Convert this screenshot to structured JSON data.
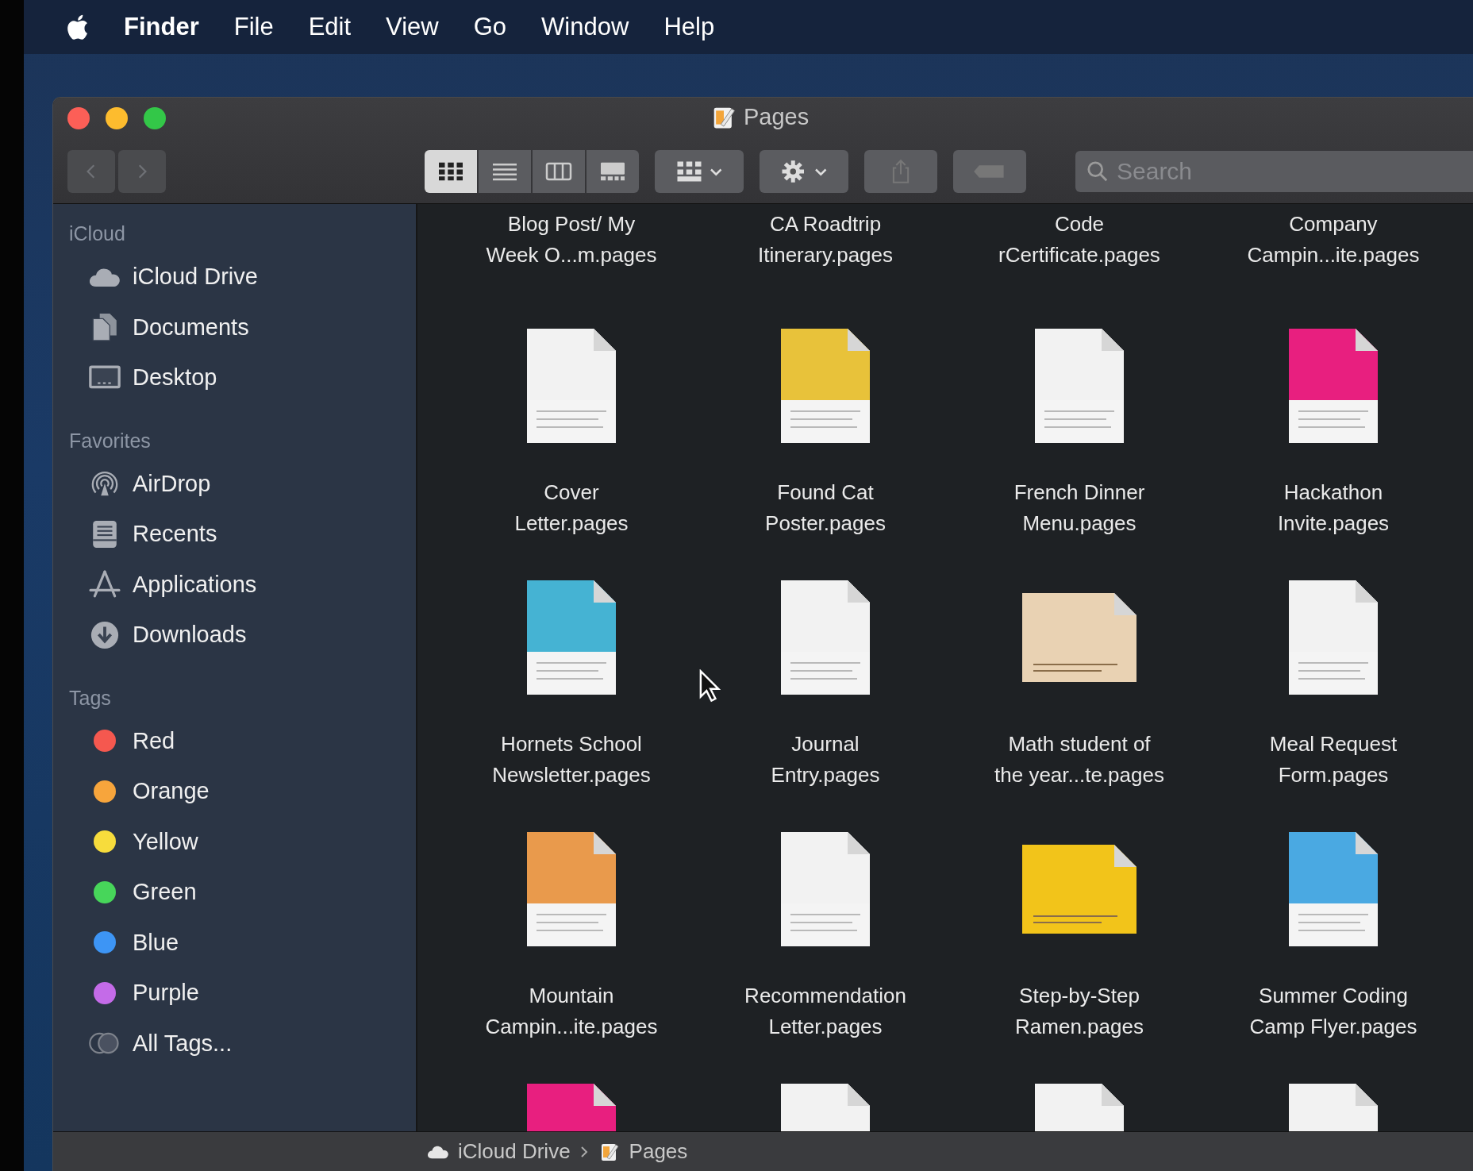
{
  "menu_bar": {
    "app": "Finder",
    "items": [
      "File",
      "Edit",
      "View",
      "Go",
      "Window",
      "Help"
    ]
  },
  "window": {
    "title": "Pages"
  },
  "toolbar": {
    "view_modes": [
      {
        "kind": "icons",
        "selected": true
      },
      {
        "kind": "list",
        "selected": false
      },
      {
        "kind": "columns",
        "selected": false
      },
      {
        "kind": "gallery",
        "selected": false
      }
    ],
    "search": {
      "placeholder": "Search"
    }
  },
  "sidebar": {
    "sections": [
      {
        "title": "iCloud",
        "items": [
          {
            "kind": "cloud",
            "label": "iCloud Drive"
          },
          {
            "kind": "documents",
            "label": "Documents"
          },
          {
            "kind": "desktop",
            "label": "Desktop"
          }
        ]
      },
      {
        "title": "Favorites",
        "items": [
          {
            "kind": "airdrop",
            "label": "AirDrop"
          },
          {
            "kind": "recents",
            "label": "Recents"
          },
          {
            "kind": "applications",
            "label": "Applications"
          },
          {
            "kind": "downloads",
            "label": "Downloads"
          }
        ]
      },
      {
        "title": "Tags",
        "items": [
          {
            "kind": "tag",
            "label": "Red",
            "color": "#f5584f"
          },
          {
            "kind": "tag",
            "label": "Orange",
            "color": "#f7a53c"
          },
          {
            "kind": "tag",
            "label": "Yellow",
            "color": "#f7dc3c"
          },
          {
            "kind": "tag",
            "label": "Green",
            "color": "#47d65a"
          },
          {
            "kind": "tag",
            "label": "Blue",
            "color": "#3d95f5"
          },
          {
            "kind": "tag",
            "label": "Purple",
            "color": "#c46be8"
          },
          {
            "kind": "all-tags",
            "label": "All Tags..."
          }
        ]
      }
    ]
  },
  "files": [
    {
      "name": "Blog Post/ My\nWeek O...m.pages"
    },
    {
      "name": "CA Roadtrip\nItinerary.pages"
    },
    {
      "name": "Code\nrCertificate.pages"
    },
    {
      "name": "Company\nCampin...ite.pages"
    },
    {
      "name": "Cover\nLetter.pages",
      "kind": "portrait",
      "color": "#f2f2f2"
    },
    {
      "name": "Found Cat\nPoster.pages",
      "kind": "portrait",
      "color": "#e8c23a"
    },
    {
      "name": "French Dinner\nMenu.pages",
      "kind": "portrait",
      "color": "#f2f2f2"
    },
    {
      "name": "Hackathon\nInvite.pages",
      "kind": "portrait",
      "color": "#e81f7f"
    },
    {
      "name": "Hornets School\nNewsletter.pages",
      "kind": "portrait",
      "color": "#45b3d3"
    },
    {
      "name": "Journal\nEntry.pages",
      "kind": "portrait",
      "color": "#f2f2f2"
    },
    {
      "name": "Math student of\nthe year...te.pages",
      "kind": "landscape",
      "color": "#e9d2b3"
    },
    {
      "name": "Meal Request\nForm.pages",
      "kind": "portrait",
      "color": "#f2f2f2"
    },
    {
      "name": "Mountain\nCampin...ite.pages",
      "kind": "portrait",
      "color": "#e99a4c"
    },
    {
      "name": "Recommendation\nLetter.pages",
      "kind": "portrait",
      "color": "#f2f2f2"
    },
    {
      "name": "Step-by-Step\nRamen.pages",
      "kind": "landscape",
      "color": "#f2c41a"
    },
    {
      "name": "Summer Coding\nCamp Flyer.pages",
      "kind": "portrait",
      "color": "#4aa9e2"
    },
    {
      "kind": "portrait",
      "color": "#e81f7f"
    },
    {
      "kind": "portrait",
      "color": "#f2f2f2"
    },
    {
      "kind": "portrait",
      "color": "#f2f2f2"
    },
    {
      "kind": "portrait",
      "color": "#f2f2f2"
    }
  ],
  "path_bar": [
    {
      "kind": "cloud",
      "label": "iCloud Drive"
    },
    {
      "kind": "pages",
      "label": "Pages"
    }
  ]
}
